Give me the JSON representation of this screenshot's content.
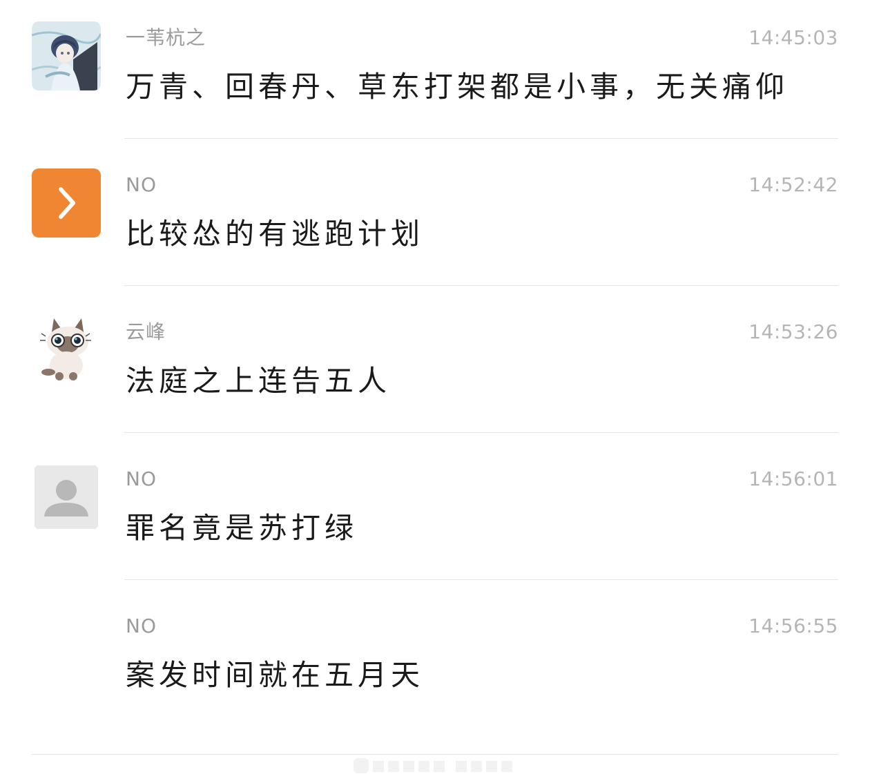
{
  "messages": [
    {
      "sender": "一苇杭之",
      "time": "14:45:03",
      "text": "万青、回春丹、草东打架都是小事，无关痛仰",
      "avatar": "anime-character-avatar"
    },
    {
      "sender": "NO",
      "time": "14:52:42",
      "text": "比较怂的有逃跑计划",
      "avatar": "orange-chevron-avatar"
    },
    {
      "sender": "云峰",
      "time": "14:53:26",
      "text": "法庭之上连告五人",
      "avatar": "siamese-cat-avatar"
    },
    {
      "sender": "NO",
      "time": "14:56:01",
      "text": "罪名竟是苏打绿",
      "avatar": "default-person-avatar"
    },
    {
      "sender": "NO",
      "time": "14:56:55",
      "text": "案发时间就在五月天",
      "avatar": ""
    }
  ],
  "colors": {
    "sender": "#9a9a9a",
    "time": "#b5b5b5",
    "text": "#1a1a1a",
    "divider": "#e5e5e5",
    "orange_avatar": "#f08532",
    "default_avatar_bg": "#e8e8e8"
  }
}
